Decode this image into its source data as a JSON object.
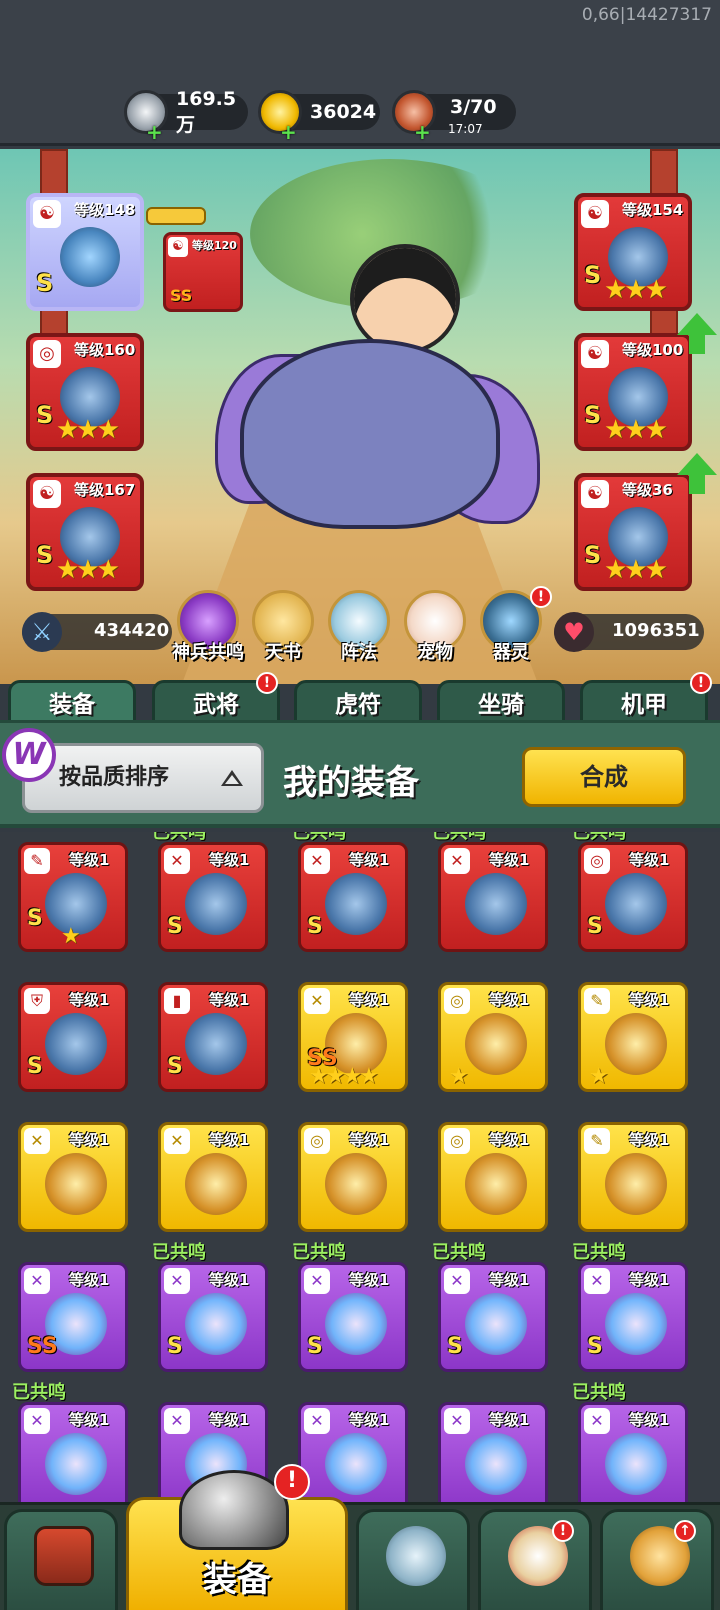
{
  "debug_text": "0,66|14427317",
  "resources": [
    {
      "name": "silver-coin",
      "value": "169.5万",
      "sub": ""
    },
    {
      "name": "gold-ingot",
      "value": "36024",
      "sub": ""
    },
    {
      "name": "meat-stamina",
      "value": "3/70",
      "sub": "17:07"
    }
  ],
  "hero": {
    "left_slots": [
      {
        "level": "等级148",
        "grade": "S",
        "stars": "",
        "badge": "☯"
      },
      {
        "level": "等级160",
        "grade": "S",
        "stars": "★★★",
        "badge": "◎"
      },
      {
        "level": "等级167",
        "grade": "S",
        "stars": "★★★",
        "badge": "☯"
      }
    ],
    "small_slot": {
      "level": "等级120",
      "grade": "SS",
      "badge": "☯"
    },
    "right_slots": [
      {
        "level": "等级154",
        "grade": "S",
        "stars": "★★★",
        "badge": "☯"
      },
      {
        "level": "等级100",
        "grade": "S",
        "stars": "★★★",
        "badge": "☯"
      },
      {
        "level": "等级36",
        "grade": "S",
        "stars": "★★★",
        "badge": "☯"
      }
    ],
    "attack": "434420",
    "hp": "1096351",
    "functions": [
      "神兵共鸣",
      "天书",
      "阵法",
      "宠物",
      "器灵"
    ]
  },
  "tabs": [
    "装备",
    "武将",
    "虎符",
    "坐骑",
    "机甲"
  ],
  "bag": {
    "sort_label": "按品质排序",
    "title": "我的装备",
    "merge_label": "合成",
    "resonance_label": "已共鸣",
    "items": [
      {
        "level": "等级1",
        "color": "red",
        "grade": "S",
        "stars": "★",
        "badge": "✎",
        "resonance": false
      },
      {
        "level": "等级1",
        "color": "red",
        "grade": "S",
        "stars": "",
        "badge": "✕",
        "resonance": true
      },
      {
        "level": "等级1",
        "color": "red",
        "grade": "S",
        "stars": "",
        "badge": "✕",
        "resonance": true
      },
      {
        "level": "等级1",
        "color": "red",
        "grade": "",
        "stars": "",
        "badge": "✕",
        "resonance": true
      },
      {
        "level": "等级1",
        "color": "red",
        "grade": "S",
        "stars": "",
        "badge": "◎",
        "resonance": true
      },
      {
        "level": "等级1",
        "color": "red",
        "grade": "S",
        "stars": "",
        "badge": "⛨",
        "resonance": false
      },
      {
        "level": "等级1",
        "color": "red",
        "grade": "S",
        "stars": "",
        "badge": "▮",
        "resonance": false
      },
      {
        "level": "等级1",
        "color": "gold",
        "grade": "SS",
        "stars": "★★★★",
        "badge": "✕",
        "resonance": false
      },
      {
        "level": "等级1",
        "color": "gold",
        "grade": "",
        "stars": "★",
        "badge": "◎",
        "resonance": false
      },
      {
        "level": "等级1",
        "color": "gold",
        "grade": "",
        "stars": "★",
        "badge": "✎",
        "resonance": false
      },
      {
        "level": "等级1",
        "color": "gold",
        "grade": "",
        "stars": "",
        "badge": "✕",
        "resonance": false
      },
      {
        "level": "等级1",
        "color": "gold",
        "grade": "",
        "stars": "",
        "badge": "✕",
        "resonance": false
      },
      {
        "level": "等级1",
        "color": "gold",
        "grade": "",
        "stars": "",
        "badge": "◎",
        "resonance": false
      },
      {
        "level": "等级1",
        "color": "gold",
        "grade": "",
        "stars": "",
        "badge": "◎",
        "resonance": false
      },
      {
        "level": "等级1",
        "color": "gold",
        "grade": "",
        "stars": "",
        "badge": "✎",
        "resonance": false
      },
      {
        "level": "等级1",
        "color": "purple",
        "grade": "SS",
        "stars": "",
        "badge": "✕",
        "resonance": false
      },
      {
        "level": "等级1",
        "color": "purple",
        "grade": "S",
        "stars": "",
        "badge": "✕",
        "resonance": true
      },
      {
        "level": "等级1",
        "color": "purple",
        "grade": "S",
        "stars": "",
        "badge": "✕",
        "resonance": true
      },
      {
        "level": "等级1",
        "color": "purple",
        "grade": "S",
        "stars": "",
        "badge": "✕",
        "resonance": true
      },
      {
        "level": "等级1",
        "color": "purple",
        "grade": "S",
        "stars": "",
        "badge": "✕",
        "resonance": true
      },
      {
        "level": "等级1",
        "color": "purple",
        "grade": "",
        "stars": "",
        "badge": "✕",
        "resonance": true
      },
      {
        "level": "等级1",
        "color": "purple",
        "grade": "",
        "stars": "",
        "badge": "✕",
        "resonance": false
      },
      {
        "level": "等级1",
        "color": "purple",
        "grade": "",
        "stars": "",
        "badge": "✕",
        "resonance": false
      },
      {
        "level": "等级1",
        "color": "purple",
        "grade": "",
        "stars": "",
        "badge": "✕",
        "resonance": false
      },
      {
        "level": "等级1",
        "color": "purple",
        "grade": "",
        "stars": "",
        "badge": "✕",
        "resonance": true
      }
    ]
  },
  "nav": {
    "active_label": "装备",
    "items": [
      "gate-icon",
      "helmet-icon",
      "crossed-swords-shield-icon",
      "horn-stars-icon",
      "fist-arrow-icon"
    ]
  },
  "colors": {
    "red_item": "#c12020",
    "gold_item": "#f0b800",
    "purple_item": "#8c36c8",
    "resonance_green": "#9cf062"
  }
}
